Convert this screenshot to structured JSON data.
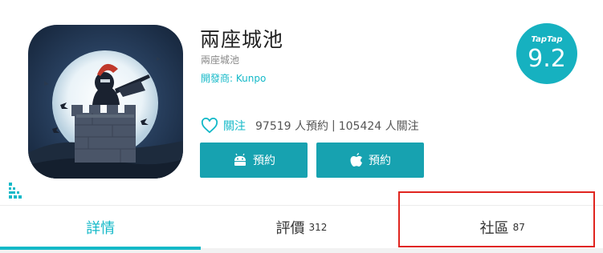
{
  "app": {
    "title": "兩座城池",
    "subtitle": "兩座城池",
    "developer": "開發商: Kunpo"
  },
  "follow": {
    "label": "關注",
    "reservations": "97519 人預約",
    "separator": "|",
    "followers": "105424 人關注"
  },
  "buttons": {
    "android_label": "預約",
    "ios_label": "預約"
  },
  "rating": {
    "brand": "TapTap",
    "score": "9.2"
  },
  "tabs": [
    {
      "label": "詳情",
      "count": "",
      "active": true
    },
    {
      "label": "評價",
      "count": "312",
      "active": false
    },
    {
      "label": "社區",
      "count": "87",
      "active": false
    }
  ],
  "colors": {
    "accent": "#14b9c8",
    "button": "#17a2b0",
    "highlight": "#e0251f"
  },
  "icons": [
    "heart-icon",
    "android-icon",
    "apple-icon",
    "qr-glyph-icon"
  ]
}
